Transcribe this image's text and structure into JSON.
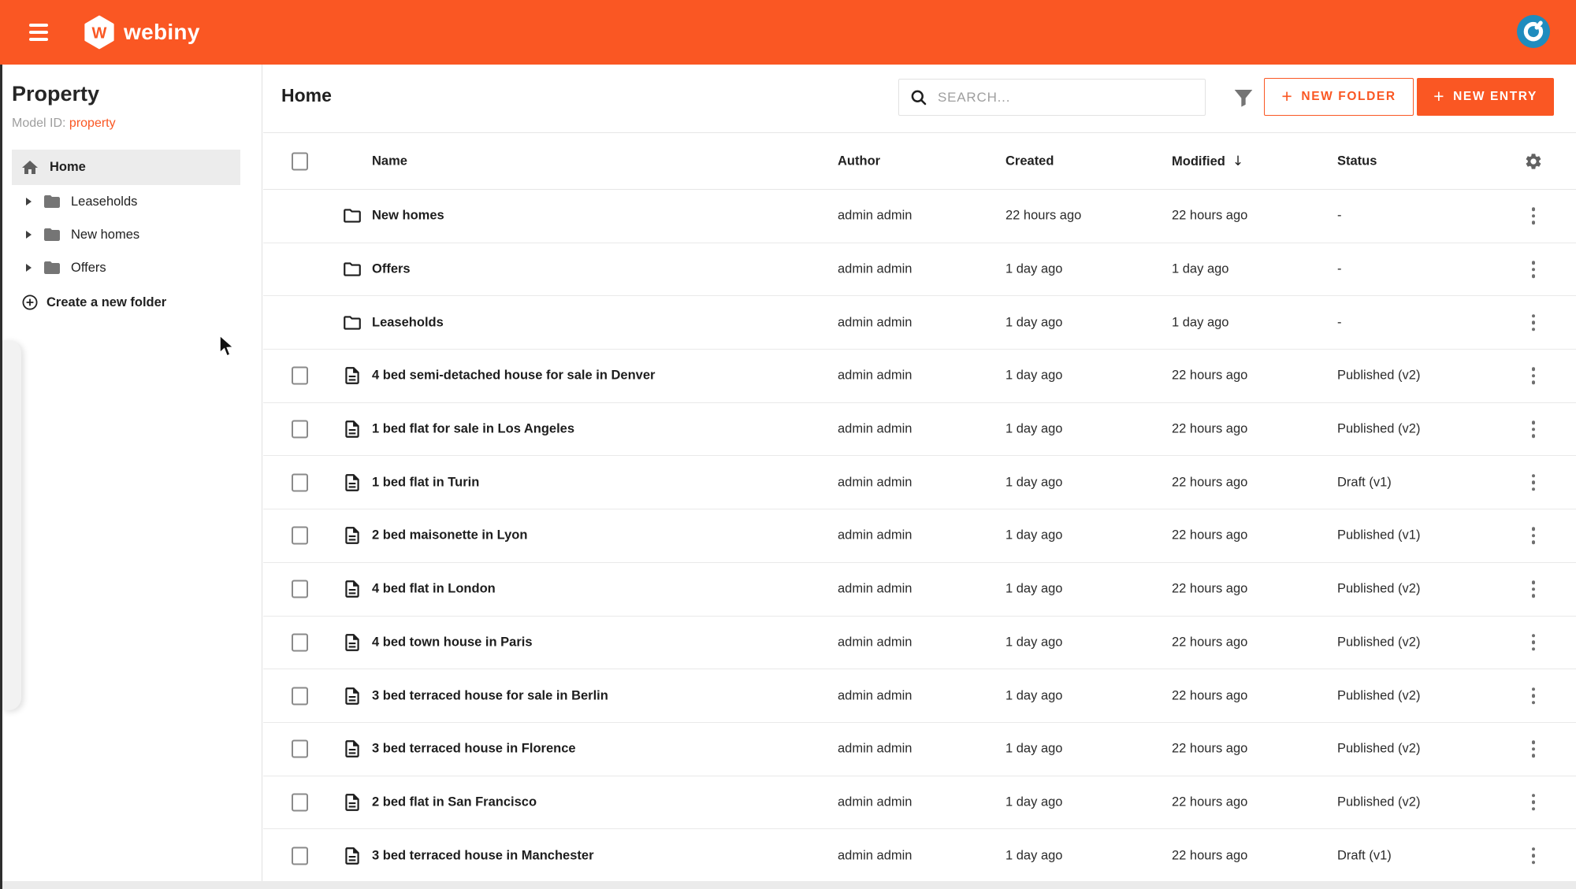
{
  "appbar": {
    "brand": "webiny",
    "logo_letter": "W"
  },
  "sidebar": {
    "title": "Property",
    "model_id_label": "Model ID:",
    "model_id_value": "property",
    "home_label": "Home",
    "folders": [
      {
        "label": "Leaseholds"
      },
      {
        "label": "New homes"
      },
      {
        "label": "Offers"
      }
    ],
    "create_folder_label": "Create a new folder"
  },
  "main": {
    "title": "Home",
    "search_placeholder": "SEARCH...",
    "new_folder_label": "NEW FOLDER",
    "new_entry_label": "NEW ENTRY"
  },
  "table": {
    "columns": {
      "name": "Name",
      "author": "Author",
      "created": "Created",
      "modified": "Modified",
      "status": "Status"
    },
    "sort": {
      "column": "Modified",
      "direction": "desc",
      "arrow": "↓"
    },
    "rows": [
      {
        "type": "folder",
        "name": "New homes",
        "author": "admin admin",
        "created": "22 hours ago",
        "modified": "22 hours ago",
        "status": "-"
      },
      {
        "type": "folder",
        "name": "Offers",
        "author": "admin admin",
        "created": "1 day ago",
        "modified": "1 day ago",
        "status": "-"
      },
      {
        "type": "folder",
        "name": "Leaseholds",
        "author": "admin admin",
        "created": "1 day ago",
        "modified": "1 day ago",
        "status": "-"
      },
      {
        "type": "entry",
        "name": "4 bed semi-detached house for sale in Denver",
        "author": "admin admin",
        "created": "1 day ago",
        "modified": "22 hours ago",
        "status": "Published (v2)"
      },
      {
        "type": "entry",
        "name": "1 bed flat for sale in Los Angeles",
        "author": "admin admin",
        "created": "1 day ago",
        "modified": "22 hours ago",
        "status": "Published (v2)"
      },
      {
        "type": "entry",
        "name": "1 bed flat in Turin",
        "author": "admin admin",
        "created": "1 day ago",
        "modified": "22 hours ago",
        "status": "Draft (v1)"
      },
      {
        "type": "entry",
        "name": "2 bed maisonette in Lyon",
        "author": "admin admin",
        "created": "1 day ago",
        "modified": "22 hours ago",
        "status": "Published (v1)"
      },
      {
        "type": "entry",
        "name": "4 bed flat in London",
        "author": "admin admin",
        "created": "1 day ago",
        "modified": "22 hours ago",
        "status": "Published (v2)"
      },
      {
        "type": "entry",
        "name": "4 bed town house in Paris",
        "author": "admin admin",
        "created": "1 day ago",
        "modified": "22 hours ago",
        "status": "Published (v2)"
      },
      {
        "type": "entry",
        "name": "3 bed terraced house for sale in Berlin",
        "author": "admin admin",
        "created": "1 day ago",
        "modified": "22 hours ago",
        "status": "Published (v2)"
      },
      {
        "type": "entry",
        "name": "3 bed terraced house in Florence",
        "author": "admin admin",
        "created": "1 day ago",
        "modified": "22 hours ago",
        "status": "Published (v2)"
      },
      {
        "type": "entry",
        "name": "2 bed flat in San Francisco",
        "author": "admin admin",
        "created": "1 day ago",
        "modified": "22 hours ago",
        "status": "Published (v2)"
      },
      {
        "type": "entry",
        "name": "3 bed terraced house in Manchester",
        "author": "admin admin",
        "created": "1 day ago",
        "modified": "22 hours ago",
        "status": "Draft (v1)"
      }
    ]
  },
  "colors": {
    "accent_orange": "#fa5723",
    "avatar_blue": "#1e8cbe",
    "text_primary": "#212121",
    "text_muted": "#9e9e9e",
    "border": "#e6e6e6",
    "selected_bg": "#ececec",
    "bottom_strip": "#ebebeb"
  },
  "icons": {
    "menu-icon": "hamburger ≡",
    "search-icon": "magnifier ⌕",
    "filter-icon": "funnel",
    "gear-icon": "⚙",
    "kebab-icon": "⋮",
    "home-icon": "⌂",
    "folder-icon": "📁",
    "document-icon": "🗎",
    "caret-right-icon": "▶",
    "plus-icon": "+",
    "plus-circle-icon": "⊕",
    "sort-desc-icon": "↓",
    "avatar-icon": "gravatar power glyph"
  }
}
